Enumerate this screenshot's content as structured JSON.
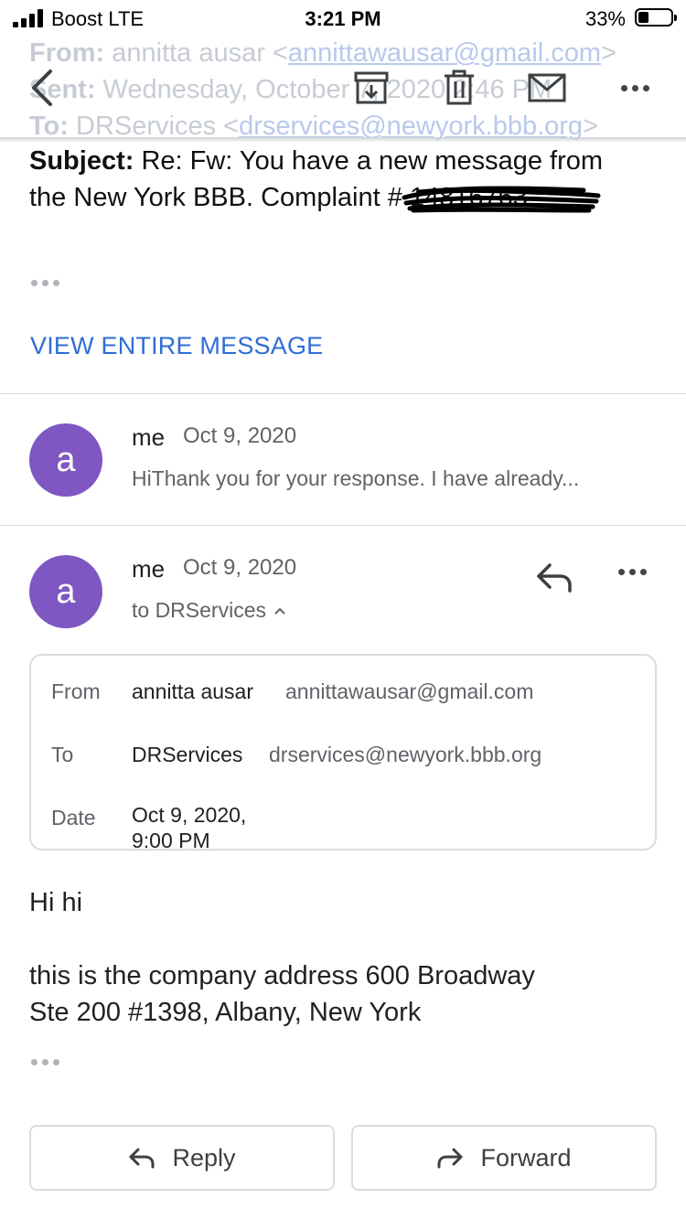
{
  "status_bar": {
    "carrier": "Boost  LTE",
    "time": "3:21 PM",
    "battery": "33%",
    "battery_level": 0.33
  },
  "faded_header": {
    "from_label": "From:",
    "from_text": "annitta ausar <",
    "from_link": "annittawausar@gmail.com",
    "from_end": ">",
    "sent_label": "Sent:",
    "sent_text": "Wednesday, October 7, 2020 2:46 PM",
    "to_label": "To:",
    "to_text": "DRServices <",
    "to_link": "drservices@newyork.bbb.org",
    "to_end": ">"
  },
  "subject": {
    "label": "Subject:",
    "line1": "Re: Fw: You have a new message from",
    "line2": "the New York BBB. Complaint # 14816763"
  },
  "view_entire": "VIEW ENTIRE MESSAGE",
  "messages": [
    {
      "avatar_letter": "a",
      "sender": "me",
      "date": "Oct 9, 2020",
      "snippet": "HiThank you for your response. I have already..."
    },
    {
      "avatar_letter": "a",
      "sender": "me",
      "date": "Oct 9, 2020",
      "to_line": "to DRServices"
    }
  ],
  "details": {
    "from_label": "From",
    "from_name": "annitta ausar",
    "from_email": "annittawausar@gmail.com",
    "to_label": "To",
    "to_name": "DRServices",
    "to_email": "drservices@newyork.bbb.org",
    "date_label": "Date",
    "date_line1": "Oct 9, 2020,",
    "date_line2": "9:00 PM"
  },
  "body": {
    "greeting": "Hi hi",
    "line1": "this is the company address 600 Broadway",
    "line2": "Ste 200 #1398, Albany, New York"
  },
  "actions": {
    "reply": "Reply",
    "forward": "Forward"
  },
  "colors": {
    "accent": "#2f6dd6",
    "avatar": "#7e57c2"
  }
}
